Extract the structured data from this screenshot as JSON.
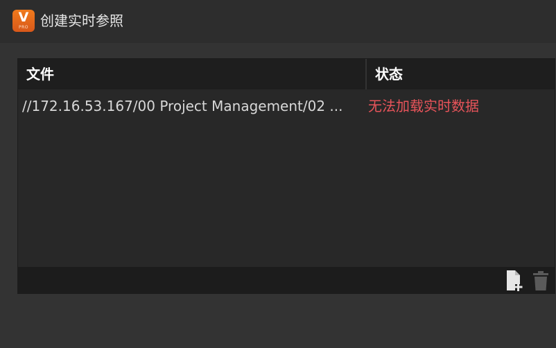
{
  "window": {
    "title": "创建实时参照",
    "app_icon": {
      "name": "vred-pro-app-icon",
      "letter": "V",
      "sub_label": "PRO",
      "color": "#e8691c"
    }
  },
  "table": {
    "columns": {
      "file": "文件",
      "status": "状态"
    },
    "rows": [
      {
        "file": "//172.16.53.167/00 Project Management/02 ...",
        "status": "无法加载实时数据",
        "status_color": "#e8545a"
      }
    ]
  },
  "toolbar": {
    "add_icon": "add-file-icon",
    "delete_icon": "trash-icon"
  },
  "colors": {
    "background": "#333333",
    "panel": "#282828",
    "header": "#1e1e1e",
    "error_text": "#e8545a"
  }
}
